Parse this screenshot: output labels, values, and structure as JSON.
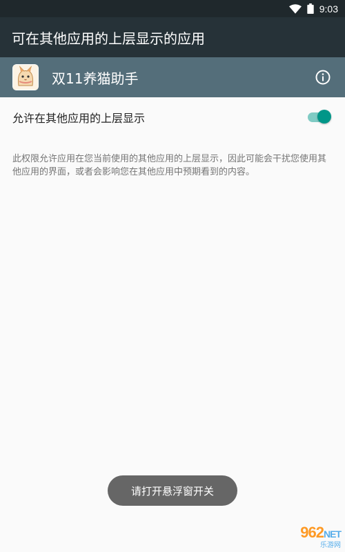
{
  "status_bar": {
    "time": "9:03",
    "icons": [
      "wifi-icon",
      "battery-icon"
    ]
  },
  "app_bar": {
    "title": "可在其他应用的上层显示的应用"
  },
  "app_row": {
    "app_name": "双11养猫助手",
    "icon": "cat-app-icon",
    "info_icon": "info-icon"
  },
  "permission": {
    "label": "允许在其他应用的上层显示",
    "enabled": true,
    "description": "此权限允许应用在您当前使用的其他应用的上层显示，因此可能会干扰您使用其他应用的界面，或者会影响您在其他应用中预期看到的内容。"
  },
  "toast": {
    "message": "请打开悬浮窗开关"
  },
  "watermark": {
    "main": "962",
    "suffix": "NET",
    "sub": "乐游网"
  },
  "colors": {
    "status_bar": "#1f282c",
    "app_bar": "#263238",
    "app_row": "#546e7a",
    "switch_on": "#009688",
    "switch_track": "#80cbc4",
    "toast": "#666666"
  }
}
